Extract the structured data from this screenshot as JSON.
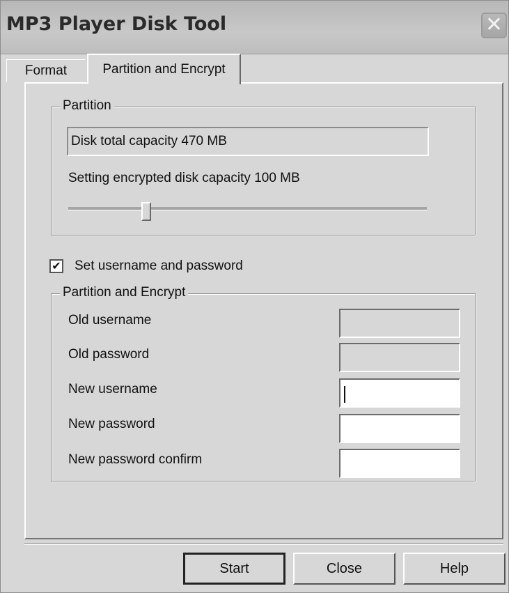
{
  "window": {
    "title": "MP3 Player Disk Tool",
    "close_glyph": "✕"
  },
  "tabs": [
    {
      "label": "Format",
      "selected": false
    },
    {
      "label": "Partition and Encrypt",
      "selected": true
    }
  ],
  "partition": {
    "legend": "Partition",
    "capacity_text": "Disk total capacity 470 MB",
    "encrypted_label": "Setting encrypted disk capacity 100 MB",
    "slider_fraction": 0.21
  },
  "auth": {
    "checkbox_label": "Set username and password",
    "checked": true,
    "check_glyph": "✔"
  },
  "encrypt": {
    "legend": "Partition and Encrypt",
    "fields": [
      {
        "label": "Old username",
        "value": "",
        "enabled": false
      },
      {
        "label": "Old password",
        "value": "",
        "enabled": false
      },
      {
        "label": "New username",
        "value": "",
        "enabled": true,
        "focused": true
      },
      {
        "label": "New password",
        "value": "",
        "enabled": true
      },
      {
        "label": "New password confirm",
        "value": "",
        "enabled": true
      }
    ]
  },
  "buttons": {
    "start": "Start",
    "close": "Close",
    "help": "Help"
  },
  "icons": {
    "close": "close-icon",
    "check": "check-icon"
  }
}
